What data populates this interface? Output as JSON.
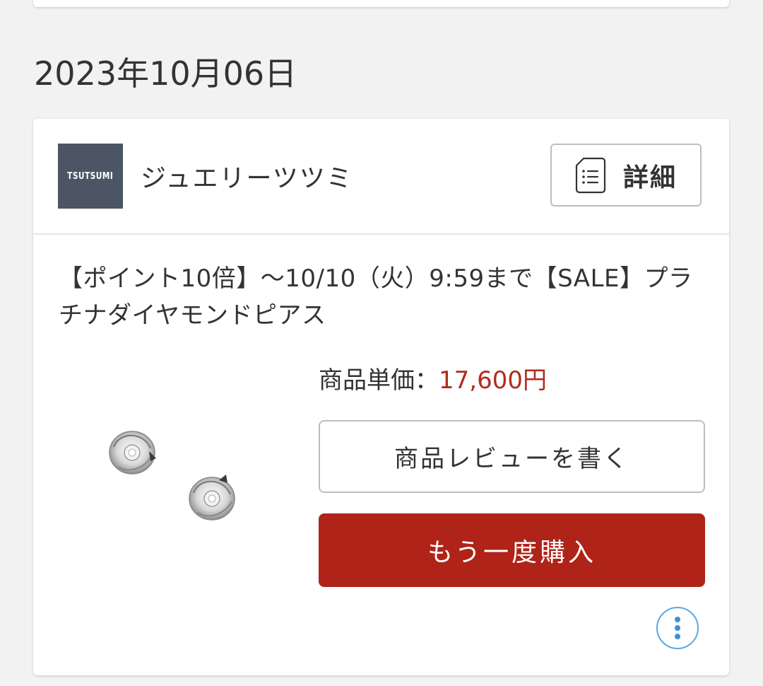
{
  "order_date": "2023年10月06日",
  "shop": {
    "logo_text": "TSUTSUMI",
    "name": "ジュエリーツツミ",
    "detail_label": "詳細"
  },
  "product": {
    "title": "【ポイント10倍】～10/10（火）9:59まで【SALE】プラチナダイヤモンドピアス",
    "price_label": "商品単価：",
    "price_value": "17,600円"
  },
  "actions": {
    "review_label": "商品レビューを書く",
    "rebuy_label": "もう一度購入"
  },
  "icons": {
    "detail": "document-list-icon",
    "more": "more-vertical-icon"
  },
  "colors": {
    "accent_red": "#af2318",
    "price_red": "#b22b1d",
    "logo_bg": "#4b5563",
    "more_blue": "#3b8fd6"
  }
}
